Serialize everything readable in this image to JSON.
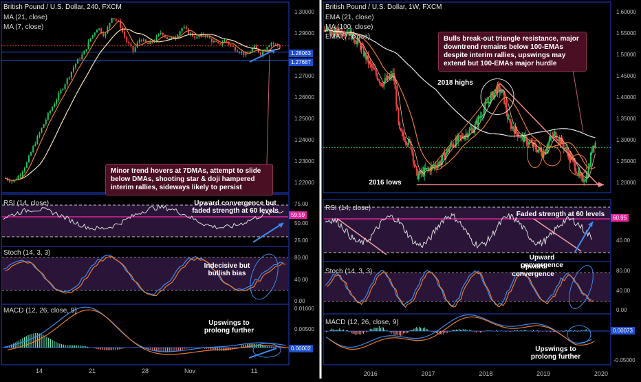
{
  "chart_data": [
    {
      "type": "line",
      "id": "left",
      "title": "British Pound / U.S. Dollar, 240, FXCM",
      "legend": [
        "MA (21, close)",
        "MA (7, close)"
      ],
      "ytick_labels": [
        "1.30000",
        "1.29000",
        "1.28063",
        "1.27687",
        "1.27000",
        "1.26000",
        "1.25000",
        "1.24000",
        "1.23000",
        "1.22000"
      ],
      "y_ticks": [
        1.3,
        1.29,
        1.27,
        1.26,
        1.25,
        1.24,
        1.23,
        1.22
      ],
      "ylim": [
        1.217,
        1.3035
      ],
      "price_labels": [
        {
          "value": 1.28063,
          "label": "1.28063",
          "color": "#1e4fd0"
        },
        {
          "value": 1.27687,
          "label": "1.27687",
          "color": "#1e4fd0"
        }
      ],
      "xtick_labels": [
        "14",
        "21",
        "28",
        "Nov",
        "11"
      ],
      "close_path": [
        [
          0,
          1.223
        ],
        [
          4,
          1.2215
        ],
        [
          8,
          1.2245
        ],
        [
          12,
          1.23
        ],
        [
          16,
          1.238
        ],
        [
          20,
          1.245
        ],
        [
          24,
          1.252
        ],
        [
          28,
          1.258
        ],
        [
          32,
          1.264
        ],
        [
          36,
          1.27
        ],
        [
          40,
          1.276
        ],
        [
          44,
          1.28
        ],
        [
          48,
          1.287
        ],
        [
          52,
          1.292
        ],
        [
          56,
          1.288
        ],
        [
          60,
          1.297
        ],
        [
          64,
          1.294
        ],
        [
          68,
          1.286
        ],
        [
          72,
          1.281
        ],
        [
          76,
          1.287
        ],
        [
          80,
          1.284
        ],
        [
          84,
          1.286
        ],
        [
          88,
          1.29
        ],
        [
          92,
          1.286
        ],
        [
          96,
          1.288
        ],
        [
          100,
          1.292
        ],
        [
          104,
          1.289
        ],
        [
          108,
          1.287
        ],
        [
          112,
          1.289
        ],
        [
          116,
          1.286
        ],
        [
          120,
          1.284
        ],
        [
          124,
          1.286
        ],
        [
          128,
          1.283
        ],
        [
          132,
          1.281
        ],
        [
          136,
          1.279
        ],
        [
          140,
          1.283
        ],
        [
          144,
          1.28
        ],
        [
          148,
          1.284
        ],
        [
          150,
          1.285
        ],
        [
          155,
          1.283
        ]
      ],
      "annotation": "Minor trend hovers at 7DMAs, attempt to slide below DMAs, shooting star & doji hampered interim rallies, sideways likely to persist",
      "rsi": {
        "label": "RSI (14, close)",
        "value_label": "59.59",
        "ticks": [
          "75.00",
          "50.00",
          "25.00"
        ],
        "note": "Upward convergence but faded strength at 60 levels"
      },
      "stoch": {
        "label": "Stoch (14, 3, 3)",
        "ticks": [
          "80.00",
          "40.00",
          "0.00"
        ],
        "note": "Indecisive but bullish bias"
      },
      "macd": {
        "label": "MACD (12, 26, close, 9)",
        "ticks": [
          "0.01000",
          "0.00500"
        ],
        "value_label": "0.00002",
        "note": "Upswings to prolong further"
      }
    },
    {
      "type": "line",
      "id": "right",
      "title": "British Pound / U.S. Dollar, 1W, FXCM",
      "legend": [
        "EMA (21, close)",
        "MA (100, close)",
        "EMA (7, close)"
      ],
      "ytick_labels": [
        "1.60000",
        "1.55000",
        "1.50000",
        "1.45000",
        "1.40000",
        "1.35000",
        "1.30000",
        "1.25000",
        "1.20000"
      ],
      "y_ticks": [
        1.6,
        1.55,
        1.5,
        1.45,
        1.4,
        1.35,
        1.3,
        1.25,
        1.2
      ],
      "ylim": [
        1.185,
        1.615
      ],
      "xtick_labels": [
        "2016",
        "2017",
        "2018",
        "2019",
        "2020"
      ],
      "x_ticks": [
        2016,
        2017,
        2018,
        2019,
        2020
      ],
      "xlim": [
        2015.18,
        2020.12
      ],
      "close_path": [
        [
          2015.2,
          1.55
        ],
        [
          2015.4,
          1.545
        ],
        [
          2015.6,
          1.55
        ],
        [
          2015.8,
          1.52
        ],
        [
          2016.0,
          1.47
        ],
        [
          2016.2,
          1.43
        ],
        [
          2016.4,
          1.45
        ],
        [
          2016.5,
          1.32
        ],
        [
          2016.7,
          1.29
        ],
        [
          2016.8,
          1.22
        ],
        [
          2017.0,
          1.235
        ],
        [
          2017.2,
          1.25
        ],
        [
          2017.4,
          1.29
        ],
        [
          2017.6,
          1.31
        ],
        [
          2017.8,
          1.33
        ],
        [
          2018.0,
          1.38
        ],
        [
          2018.1,
          1.4
        ],
        [
          2018.2,
          1.42
        ],
        [
          2018.3,
          1.405
        ],
        [
          2018.4,
          1.34
        ],
        [
          2018.6,
          1.31
        ],
        [
          2018.8,
          1.29
        ],
        [
          2019.0,
          1.27
        ],
        [
          2019.1,
          1.3
        ],
        [
          2019.2,
          1.315
        ],
        [
          2019.3,
          1.3
        ],
        [
          2019.5,
          1.255
        ],
        [
          2019.65,
          1.21
        ],
        [
          2019.75,
          1.22
        ],
        [
          2019.8,
          1.245
        ],
        [
          2019.85,
          1.29
        ],
        [
          2019.9,
          1.295
        ]
      ],
      "annotations": {
        "box": "Bulls break-out triangle resistance, major downtrend remains below 100-EMAs despite interim rallies, upswings may extend but 100-EMAs major hurdle",
        "highs": "2018 highs",
        "lows": "2016 lows"
      },
      "rsi": {
        "label": "RSI (14, close)",
        "value_label": "60.95",
        "ticks": [
          "40.00"
        ],
        "note": "Faded strength at 60 levels",
        "note2": "Upward convergence"
      },
      "stoch": {
        "label": "Stoch (14, 3, 3)",
        "ticks": [
          "80.00",
          "40.00",
          "0.00"
        ],
        "note": "Upward convergence"
      },
      "macd": {
        "label": "MACD (12, 26, close, 9)",
        "value_label": "0.00073",
        "ticks": [
          "-0.05000"
        ],
        "note": "Upswings to prolong further"
      }
    }
  ]
}
